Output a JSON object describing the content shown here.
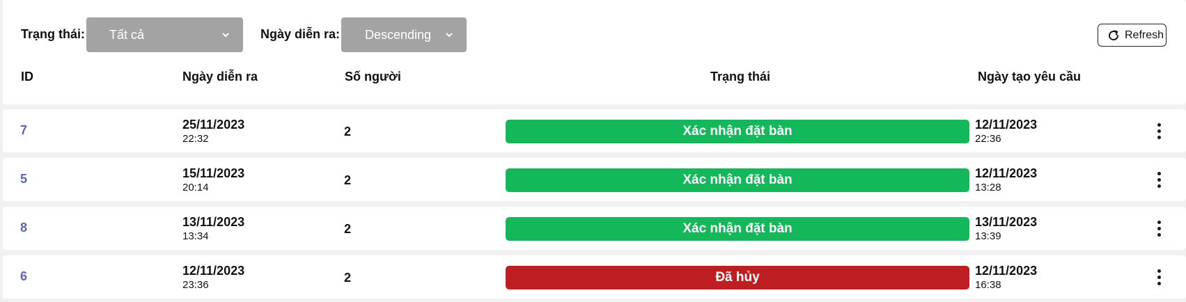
{
  "filters": {
    "status_label": "Trạng thái:",
    "status_value": "Tất cả",
    "date_label": "Ngày diễn ra:",
    "date_value": "Descending",
    "refresh_label": "Refresh"
  },
  "columns": {
    "id": "ID",
    "event_date": "Ngày diễn ra",
    "people": "Số người",
    "status": "Trạng thái",
    "created": "Ngày tạo yêu cầu"
  },
  "colors": {
    "confirmed": "#13b85a",
    "cancelled": "#be1e22",
    "id_link": "#5d63b8",
    "select_bg": "#a3a3a3"
  },
  "rows": [
    {
      "id": "7",
      "event_date": "25/11/2023",
      "event_time": "22:32",
      "people": "2",
      "status": "Xác nhận đặt bàn",
      "status_type": "confirmed",
      "created_date": "12/11/2023",
      "created_time": "22:36"
    },
    {
      "id": "5",
      "event_date": "15/11/2023",
      "event_time": "20:14",
      "people": "2",
      "status": "Xác nhận đặt bàn",
      "status_type": "confirmed",
      "created_date": "12/11/2023",
      "created_time": "13:28"
    },
    {
      "id": "8",
      "event_date": "13/11/2023",
      "event_time": "13:34",
      "people": "2",
      "status": "Xác nhận đặt bàn",
      "status_type": "confirmed",
      "created_date": "13/11/2023",
      "created_time": "13:39"
    },
    {
      "id": "6",
      "event_date": "12/11/2023",
      "event_time": "23:36",
      "people": "2",
      "status": "Đã hủy",
      "status_type": "cancelled",
      "created_date": "12/11/2023",
      "created_time": "16:38"
    }
  ]
}
